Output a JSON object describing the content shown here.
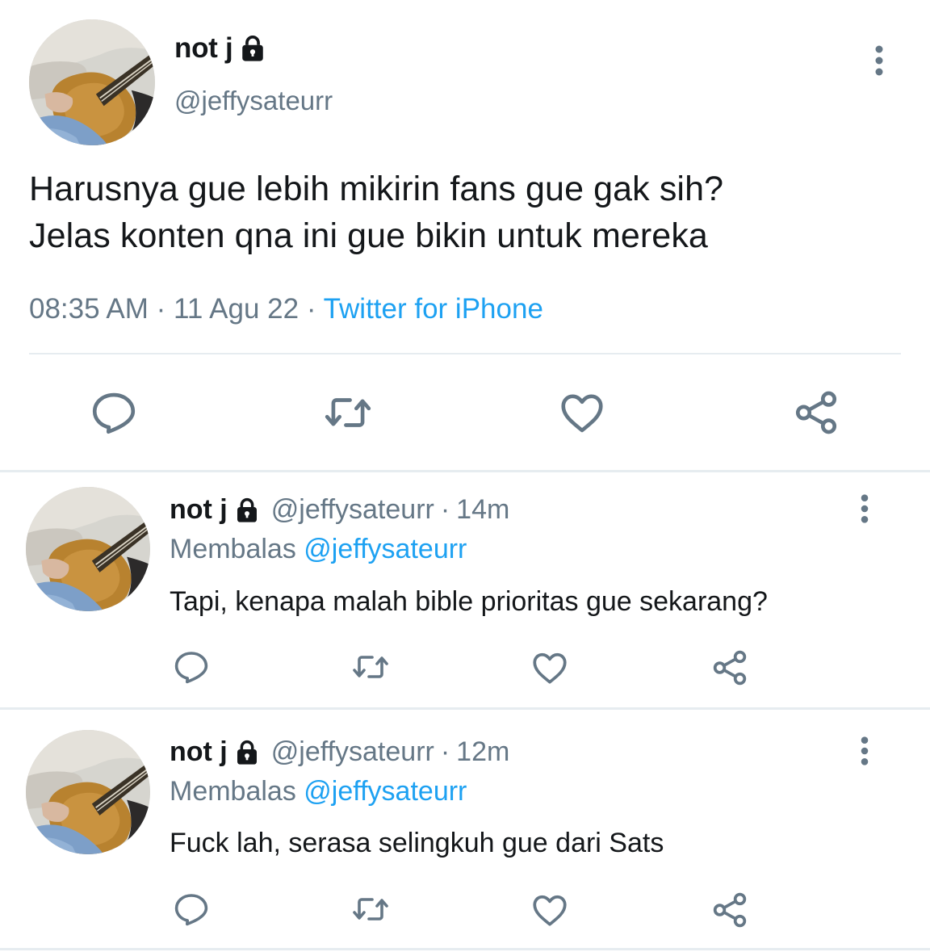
{
  "main_tweet": {
    "display_name": "not j",
    "handle": "@jeffysateurr",
    "text_lines": [
      "Harusnya gue lebih mikirin fans gue gak sih?",
      "Jelas konten qna ini gue bikin untuk mereka"
    ],
    "time": "08:35 AM",
    "separator": "·",
    "date": "11 Agu 22",
    "source": "Twitter for iPhone"
  },
  "replies": [
    {
      "display_name": "not j",
      "handle": "@jeffysateurr",
      "separator": "·",
      "age": "14m",
      "replying_label": "Membalas",
      "replying_to": "@jeffysateurr",
      "text": "Tapi, kenapa malah bible prioritas gue sekarang?"
    },
    {
      "display_name": "not j",
      "handle": "@jeffysateurr",
      "separator": "·",
      "age": "12m",
      "replying_label": "Membalas",
      "replying_to": "@jeffysateurr",
      "text": "Fuck lah, serasa selingkuh gue dari Sats"
    }
  ],
  "icons": {
    "lock": "lock-icon",
    "more": "more-vertical-icon",
    "reply": "reply-icon",
    "retweet": "retweet-icon",
    "like": "heart-icon",
    "share": "share-icon"
  },
  "colors": {
    "text_primary": "#14171a",
    "text_secondary": "#657786",
    "link": "#1da1f2",
    "divider": "#e6ecf0"
  }
}
